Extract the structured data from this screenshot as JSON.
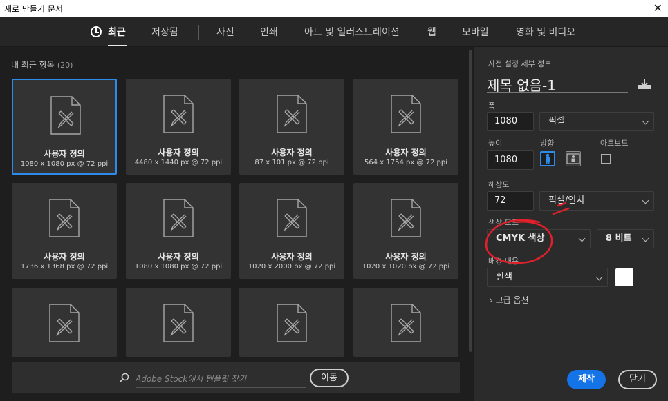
{
  "window": {
    "title": "새로 만들기 문서"
  },
  "tabs": [
    {
      "label": "최근",
      "active": true
    },
    {
      "label": "저장됨"
    },
    {
      "label": "사진"
    },
    {
      "label": "인쇄"
    },
    {
      "label": "아트 및 일러스트레이션"
    },
    {
      "label": "웹"
    },
    {
      "label": "모바일"
    },
    {
      "label": "영화 및 비디오"
    }
  ],
  "recent": {
    "title": "내 최근 항목",
    "count": "(20)",
    "items": [
      {
        "name": "사용자 정의",
        "size": "1080 x 1080 px @ 72 ppi",
        "selected": true
      },
      {
        "name": "사용자 정의",
        "size": "4480 x 1440 px @ 72 ppi"
      },
      {
        "name": "사용자 정의",
        "size": "87 x 101 px @ 72 ppi"
      },
      {
        "name": "사용자 정의",
        "size": "564 x 1754 px @ 72 ppi"
      },
      {
        "name": "사용자 정의",
        "size": "1736 x 1368 px @ 72 ppi"
      },
      {
        "name": "사용자 정의",
        "size": "1080 x 1080 px @ 72 ppi"
      },
      {
        "name": "사용자 정의",
        "size": "1020 x 2000 px @ 72 ppi"
      },
      {
        "name": "사용자 정의",
        "size": "1020 x 1020 px @ 72 ppi"
      },
      {
        "name": "",
        "size": ""
      },
      {
        "name": "",
        "size": ""
      },
      {
        "name": "",
        "size": ""
      },
      {
        "name": "",
        "size": ""
      }
    ]
  },
  "search": {
    "placeholder": "Adobe Stock에서 템플릿 찾기",
    "go_label": "이동"
  },
  "preset": {
    "section_label": "사전 설정 세부 정보",
    "doc_title": "제목 없음-1",
    "width_label": "폭",
    "width_value": "1080",
    "width_unit": "픽셀",
    "height_label": "높이",
    "height_value": "1080",
    "orientation_label": "방향",
    "artboard_label": "아트보드",
    "resolution_label": "해상도",
    "resolution_value": "72",
    "resolution_unit": "픽셀/인치",
    "color_mode_label": "색상 모드",
    "color_mode_value": "CMYK 색상",
    "bit_depth_value": "8 비트",
    "background_label": "배경 내용",
    "background_value": "흰색",
    "background_color": "#ffffff",
    "advanced_label": "고급 옵션"
  },
  "actions": {
    "create_label": "제작",
    "close_label": "닫기"
  },
  "colors": {
    "accent": "#2d8ceb",
    "button_blue": "#1473e6",
    "annotation_red": "#e0202a"
  },
  "icons": [
    "clock-icon",
    "document-icon",
    "search-icon",
    "save-preset-icon",
    "portrait-icon",
    "landscape-icon",
    "chevron-down-icon",
    "chevron-right-icon",
    "close-icon"
  ]
}
